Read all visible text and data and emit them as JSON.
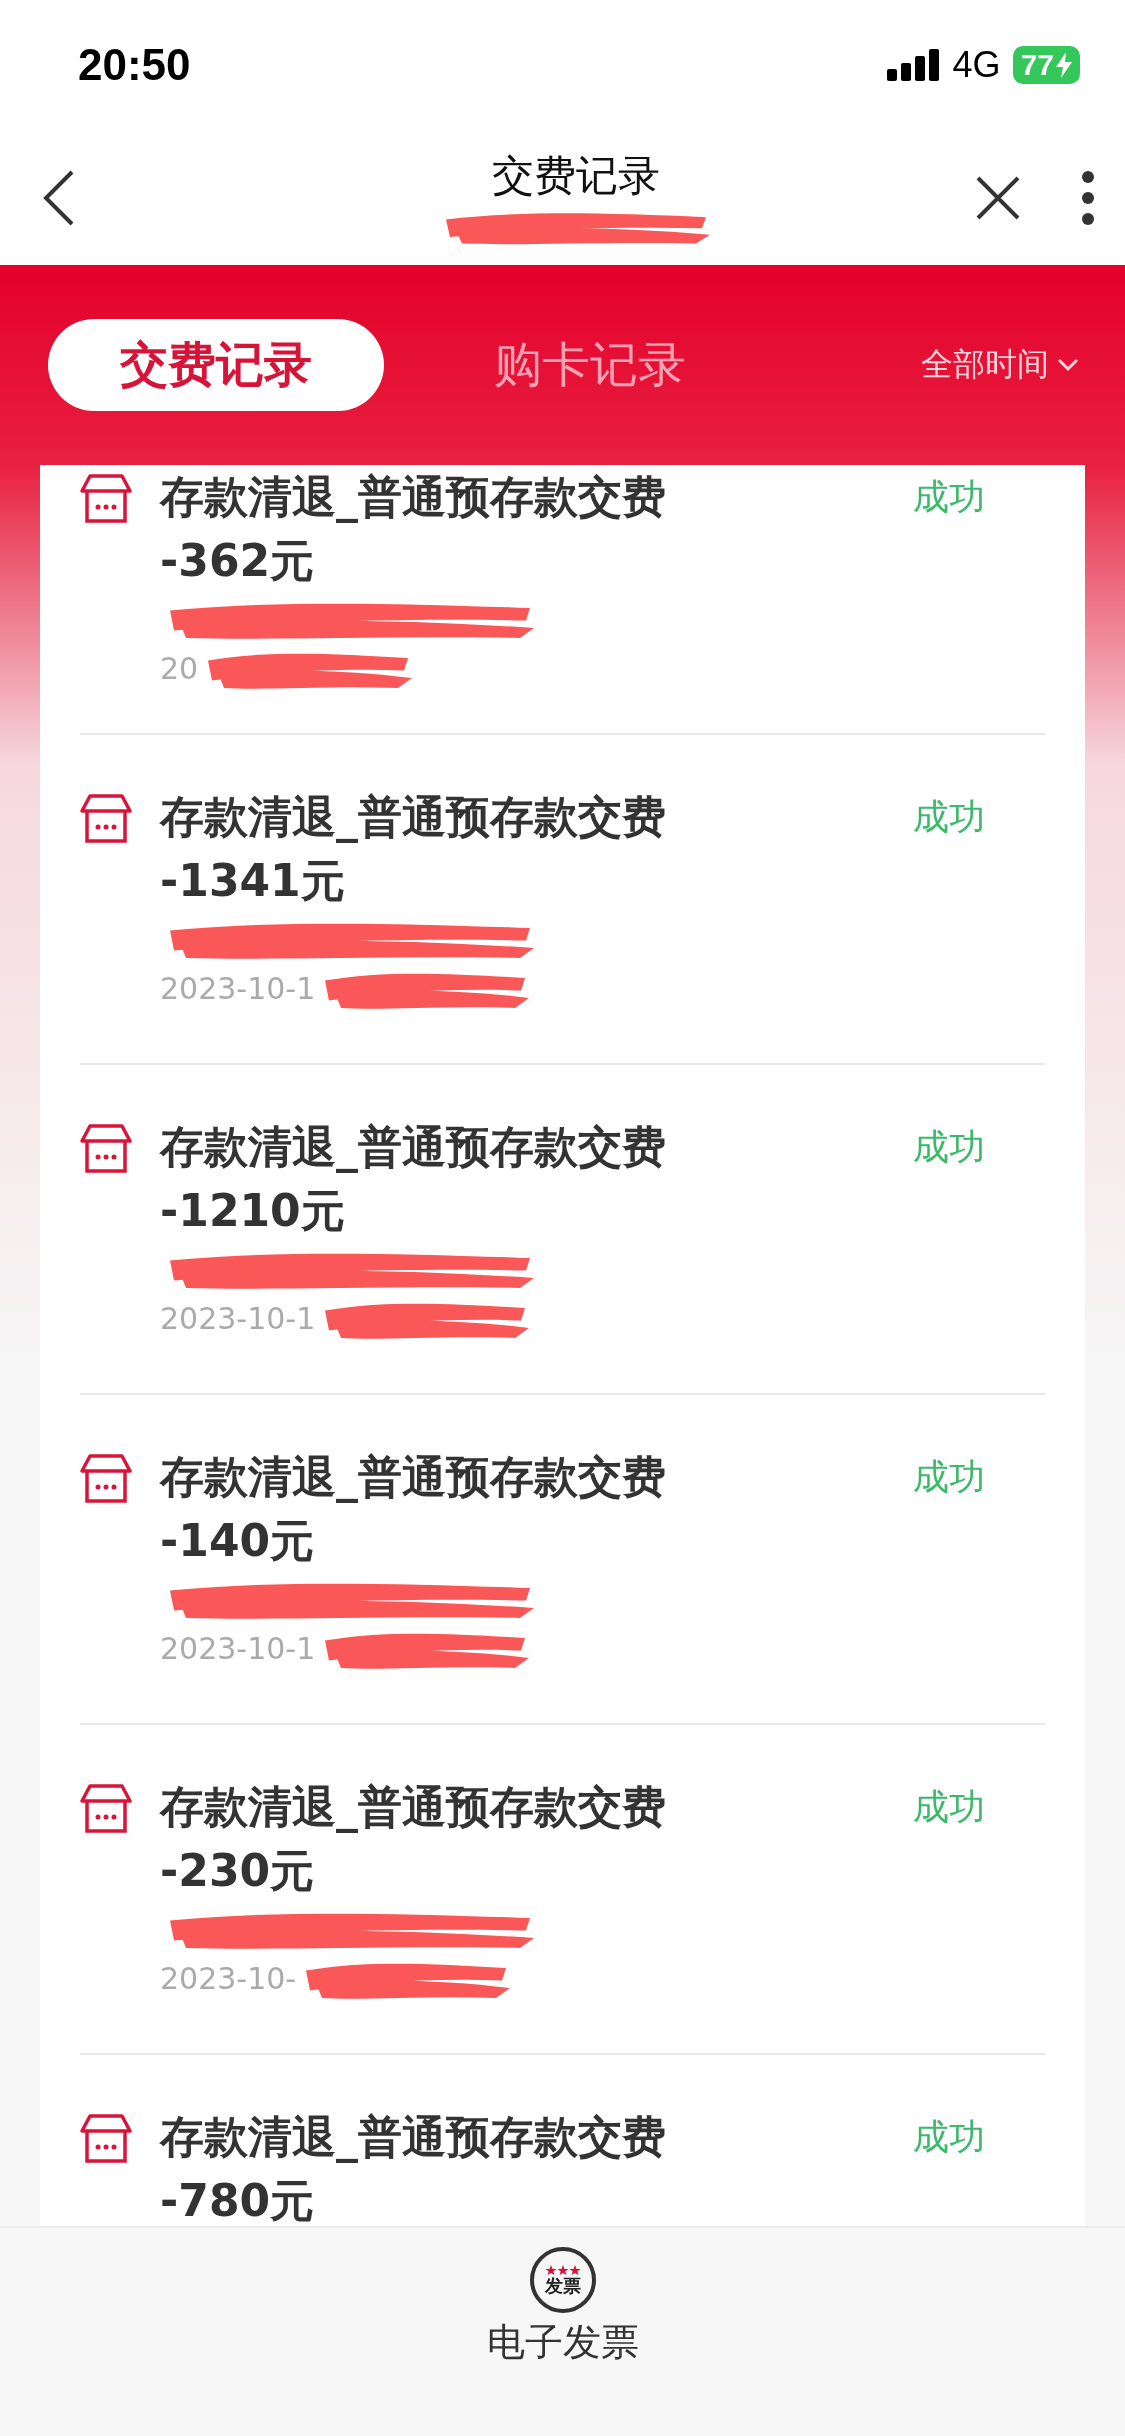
{
  "status_bar": {
    "time": "20:50",
    "network": "4G",
    "battery": "77"
  },
  "header": {
    "title": "交费记录"
  },
  "tabs": [
    {
      "label": "交费记录",
      "selected": true
    },
    {
      "label": "购卡记录",
      "selected": false
    }
  ],
  "time_filter": {
    "label": "全部时间"
  },
  "records": [
    {
      "title": "存款清退_普通预存款交费",
      "amount": "-362元",
      "status": "成功",
      "date": "20"
    },
    {
      "title": "存款清退_普通预存款交费",
      "amount": "-1341元",
      "status": "成功",
      "date": "2023-10-1"
    },
    {
      "title": "存款清退_普通预存款交费",
      "amount": "-1210元",
      "status": "成功",
      "date": "2023-10-1"
    },
    {
      "title": "存款清退_普通预存款交费",
      "amount": "-140元",
      "status": "成功",
      "date": "2023-10-1"
    },
    {
      "title": "存款清退_普通预存款交费",
      "amount": "-230元",
      "status": "成功",
      "date": "2023-10-"
    },
    {
      "title": "存款清退_普通预存款交费",
      "amount": "-780元",
      "status": "成功"
    }
  ],
  "bottom_bar": {
    "icon_text": "发票",
    "label": "电子发票"
  }
}
